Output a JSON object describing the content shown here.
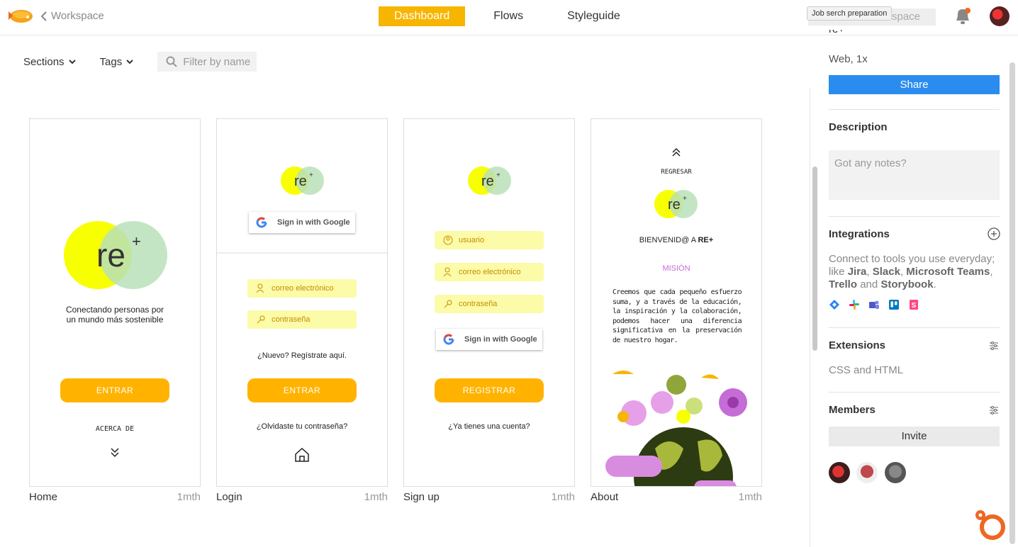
{
  "topbar": {
    "back_label": "Workspace",
    "tabs": [
      "Dashboard",
      "Flows",
      "Styleguide"
    ],
    "active_tab": "Dashboard",
    "workspace_search_placeholder": "space",
    "tooltip": "Job serch preparation"
  },
  "filters": {
    "sections_label": "Sections",
    "tags_label": "Tags",
    "filter_placeholder": "Filter by name"
  },
  "screens": [
    {
      "name": "Home",
      "time": "1mth",
      "tagline_1": "Conectando personas por",
      "tagline_2": "un mundo más sostenible",
      "enter": "ENTRAR",
      "about": "ACERCA DE"
    },
    {
      "name": "Login",
      "time": "1mth",
      "google": "Sign in with Google",
      "email": "correo electrónico",
      "password": "contraseña",
      "new_user": "¿Nuevo? Regístrate aquí.",
      "enter": "ENTRAR",
      "forgot": "¿Olvidaste tu contraseña?"
    },
    {
      "name": "Sign up",
      "time": "1mth",
      "user": "usuario",
      "email": "correo electrónico",
      "password": "contraseña",
      "google": "Sign in with Google",
      "register": "REGISTRAR",
      "have_account": "¿Ya tienes una cuenta?"
    },
    {
      "name": "About",
      "time": "1mth",
      "back": "REGRESAR",
      "welcome": "BIENVENID@ A",
      "brand": "RE+",
      "mission": "MISIÓN",
      "mission_text": "Creemos que cada pequeño esfuerzo suma, y a través de la educación, la inspiración y la colaboración, podemos hacer una diferencia significativa en la preservación de nuestro hogar."
    }
  ],
  "logo_text": "re",
  "panel": {
    "title_fragment": "re+",
    "platform": "Web, 1x",
    "share": "Share",
    "description_title": "Description",
    "notes_placeholder": "Got any notes?",
    "integrations_title": "Integrations",
    "integrations_text_1": "Connect to tools you use everyday;",
    "integrations_text_2": "like",
    "tools": [
      "Jira",
      "Slack",
      "Microsoft Teams",
      "Trello",
      "Storybook"
    ],
    "integrations_and": "and",
    "extensions_title": "Extensions",
    "extensions_value": "CSS and HTML",
    "members_title": "Members",
    "invite": "Invite"
  },
  "colors": {
    "accent": "#f7b500",
    "share_blue": "#2b8cf0",
    "logo_yellow": "#f7ff00",
    "logo_green": "#b9e0b9"
  }
}
